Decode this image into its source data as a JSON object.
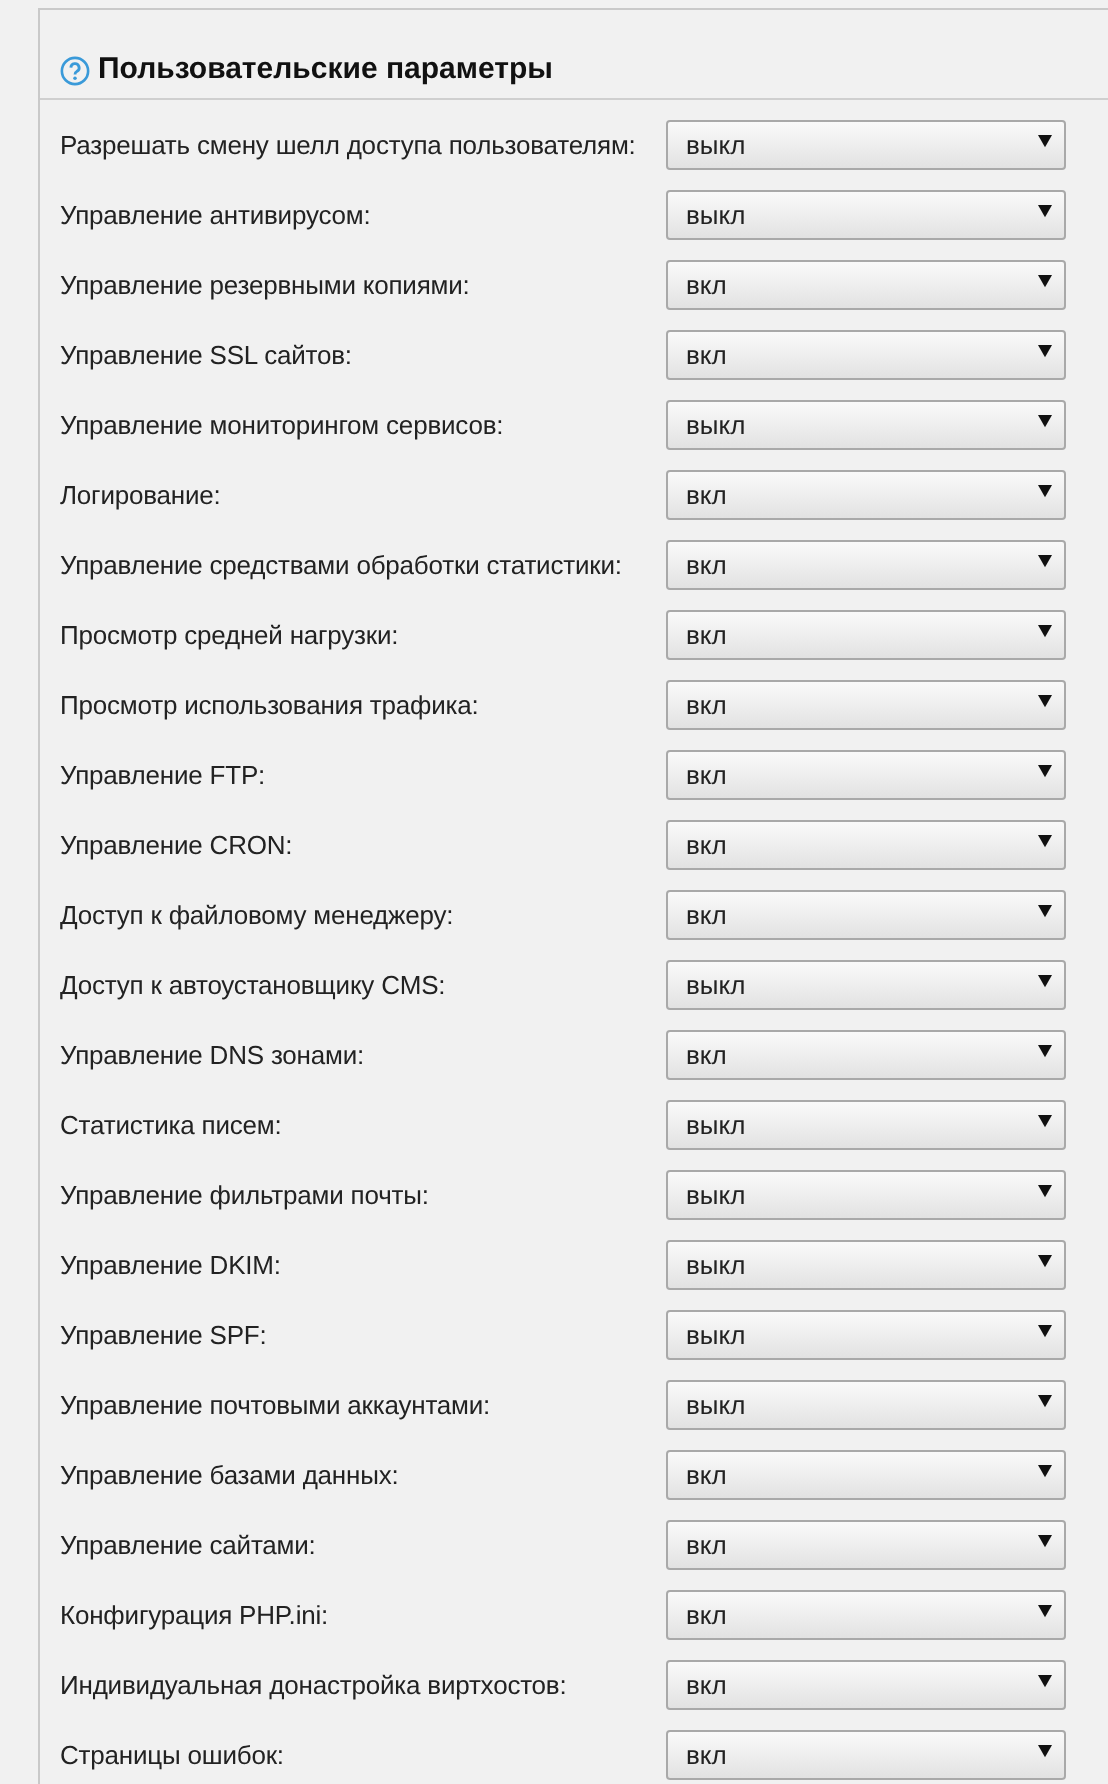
{
  "section": {
    "title": "Пользовательские параметры"
  },
  "settings": [
    {
      "label": "Разрешать смену шелл доступа пользователям:",
      "value": "выкл"
    },
    {
      "label": "Управление антивирусом:",
      "value": "выкл"
    },
    {
      "label": "Управление резервными копиями:",
      "value": "вкл"
    },
    {
      "label": "Управление SSL сайтов:",
      "value": "вкл"
    },
    {
      "label": "Управление мониторингом сервисов:",
      "value": "выкл"
    },
    {
      "label": "Логирование:",
      "value": "вкл"
    },
    {
      "label": "Управление средствами обработки статистики:",
      "value": "вкл"
    },
    {
      "label": "Просмотр средней нагрузки:",
      "value": "вкл"
    },
    {
      "label": "Просмотр использования трафика:",
      "value": "вкл"
    },
    {
      "label": "Управление FTP:",
      "value": "вкл"
    },
    {
      "label": "Управление CRON:",
      "value": "вкл"
    },
    {
      "label": "Доступ к файловому менеджеру:",
      "value": "вкл"
    },
    {
      "label": "Доступ к автоустановщику CMS:",
      "value": "выкл"
    },
    {
      "label": "Управление DNS зонами:",
      "value": "вкл"
    },
    {
      "label": "Статистика писем:",
      "value": "выкл"
    },
    {
      "label": "Управление фильтрами почты:",
      "value": "выкл"
    },
    {
      "label": "Управление DKIM:",
      "value": "выкл"
    },
    {
      "label": "Управление SPF:",
      "value": "выкл"
    },
    {
      "label": "Управление почтовыми аккаунтами:",
      "value": "выкл"
    },
    {
      "label": "Управление базами данных:",
      "value": "вкл"
    },
    {
      "label": "Управление сайтами:",
      "value": "вкл"
    },
    {
      "label": "Конфигурация PHP.ini:",
      "value": "вкл"
    },
    {
      "label": "Индивидуальная донастройка виртхостов:",
      "value": "вкл"
    },
    {
      "label": "Страницы ошибок:",
      "value": "вкл"
    }
  ]
}
